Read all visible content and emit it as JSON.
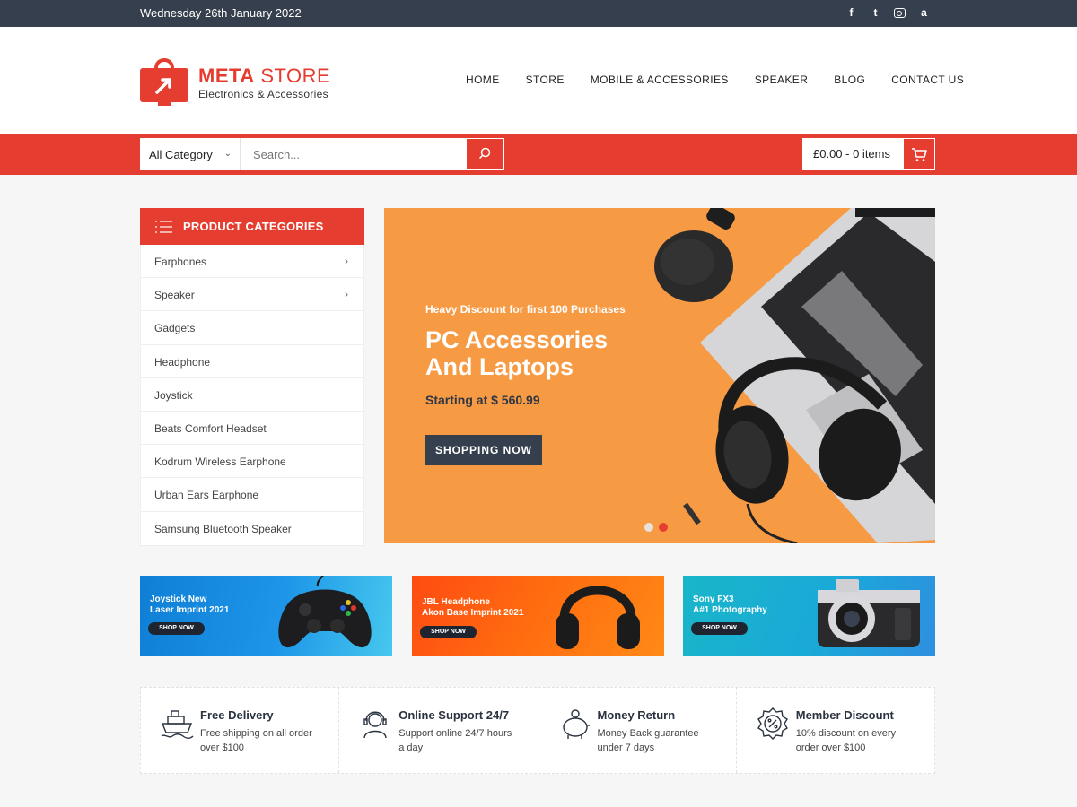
{
  "topbar": {
    "date": "Wednesday 26th January 2022",
    "social": [
      "f",
      "t",
      "instagram",
      "a"
    ]
  },
  "brand": {
    "name_bold": "META",
    "name_rest": " STORE",
    "tagline": "Electronics & Accessories"
  },
  "nav": [
    "HOME",
    "STORE",
    "MOBILE & ACCESSORIES",
    "SPEAKER",
    "BLOG",
    "CONTACT US"
  ],
  "search": {
    "category": "All Category",
    "placeholder": "Search..."
  },
  "cart": {
    "summary": "£0.00 - 0 items"
  },
  "categories": {
    "title": "PRODUCT CATEGORIES",
    "items": [
      {
        "label": "Earphones"
      },
      {
        "label": "Speaker"
      },
      {
        "label": "Gadgets"
      },
      {
        "label": "Headphone"
      },
      {
        "label": "Joystick"
      },
      {
        "label": "Beats Comfort Headset"
      },
      {
        "label": "Kodrum Wireless Earphone"
      },
      {
        "label": "Urban Ears Earphone"
      },
      {
        "label": "Samsung Bluetooth Speaker"
      }
    ]
  },
  "hero": {
    "kicker": "Heavy Discount for first 100 Purchases",
    "headline": "PC Accessories And Laptops",
    "price": "Starting at $ 560.99",
    "cta": "SHOPPING NOW"
  },
  "promos": [
    {
      "line1": "Joystick New",
      "line2": "Laser Imprint 2021",
      "cta": "SHOP NOW"
    },
    {
      "line1": "JBL Headphone",
      "line2": "Akon Base Imprint 2021",
      "cta": "SHOP NOW"
    },
    {
      "line1": "Sony FX3",
      "line2": "A#1 Photography",
      "cta": "SHOP NOW"
    }
  ],
  "features": [
    {
      "title": "Free Delivery",
      "desc": "Free shipping on all order over $100",
      "icon": "ship-icon"
    },
    {
      "title": "Online Support 24/7",
      "desc": "Support online 24/7 hours a day",
      "icon": "support-agent-icon"
    },
    {
      "title": "Money Return",
      "desc": "Money Back guarantee under 7 days",
      "icon": "piggy-bank-icon"
    },
    {
      "title": "Member Discount",
      "desc": "10% discount on every order over $100",
      "icon": "discount-badge-icon"
    }
  ],
  "colors": {
    "accent": "#e53e30",
    "dark": "#363f4d",
    "hero_bg": "#f79a44"
  }
}
